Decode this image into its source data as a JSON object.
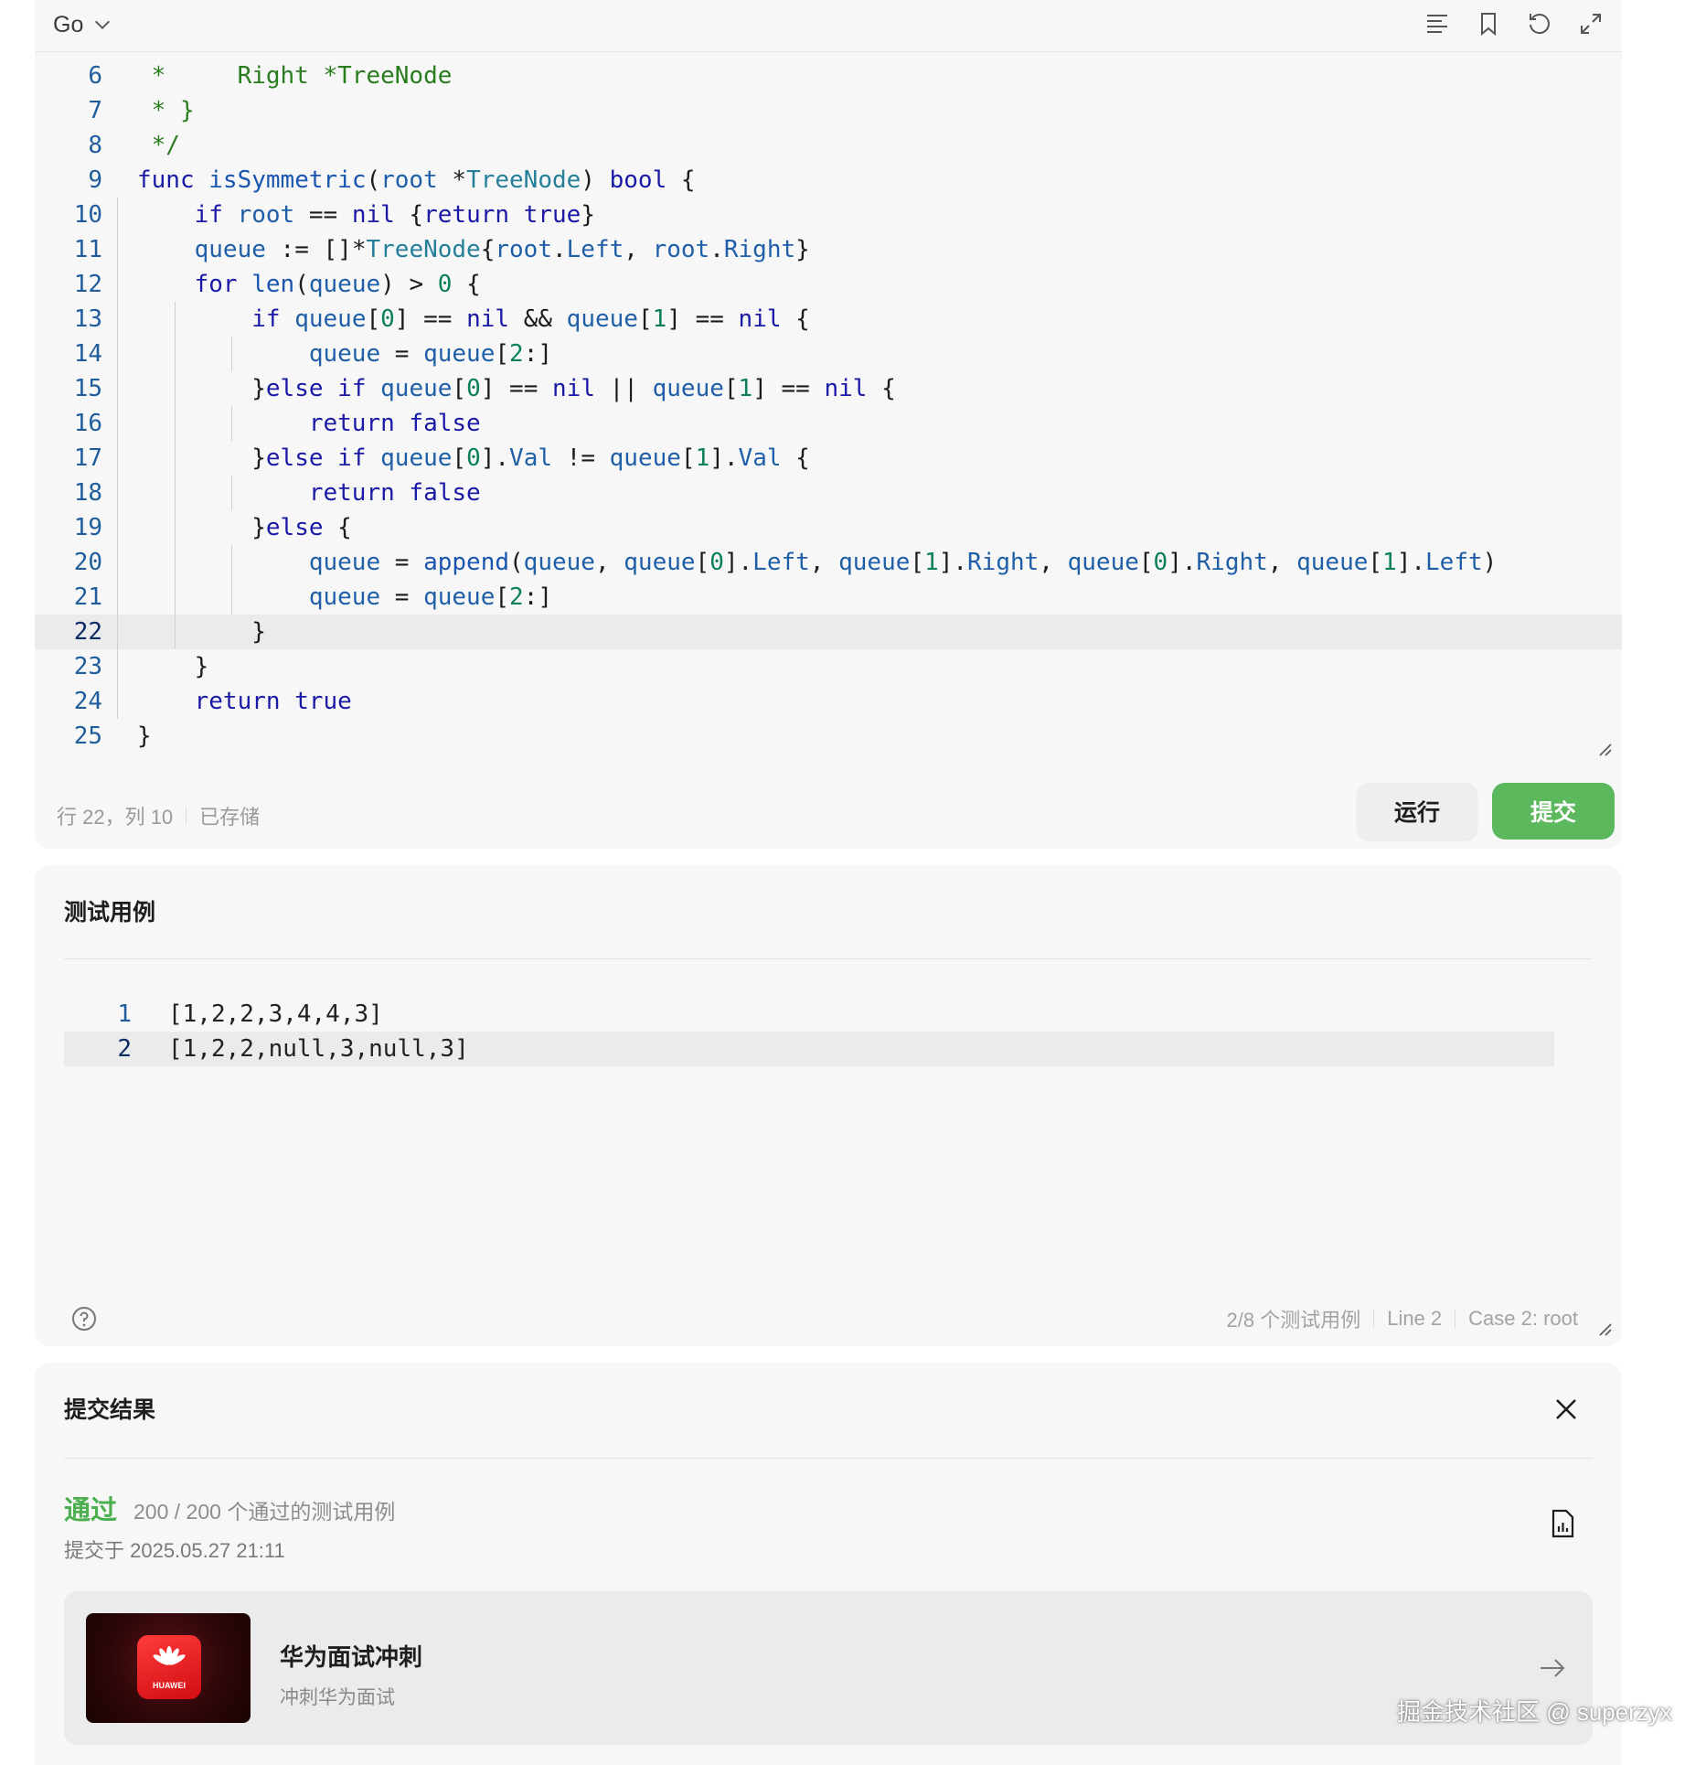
{
  "editor": {
    "language": "Go",
    "code_lines": [
      {
        "n": "6",
        "html": "<span class='c'> *     Right *TreeNode</span>"
      },
      {
        "n": "7",
        "html": "<span class='c'> * }</span>"
      },
      {
        "n": "8",
        "html": "<span class='c'> */</span>"
      },
      {
        "n": "9",
        "html": "<span class='k'>func</span> <span class='f'>isSymmetric</span>(<span class='v'>root</span> *<span class='t'>TreeNode</span>) <span class='k'>bool</span> {"
      },
      {
        "n": "10",
        "html": "    <span class='k'>if</span> <span class='v'>root</span> == <span class='k'>nil</span> {<span class='k'>return</span> <span class='k'>true</span>}"
      },
      {
        "n": "11",
        "html": "    <span class='v'>queue</span> := []*<span class='t'>TreeNode</span>{<span class='v'>root</span>.<span class='v'>Left</span>, <span class='v'>root</span>.<span class='v'>Right</span>}"
      },
      {
        "n": "12",
        "html": "    <span class='k'>for</span> <span class='f'>len</span>(<span class='v'>queue</span>) > <span class='n'>0</span> {"
      },
      {
        "n": "13",
        "html": "        <span class='k'>if</span> <span class='v'>queue</span>[<span class='n'>0</span>] == <span class='k'>nil</span> && <span class='v'>queue</span>[<span class='n'>1</span>] == <span class='k'>nil</span> {"
      },
      {
        "n": "14",
        "html": "            <span class='v'>queue</span> = <span class='v'>queue</span>[<span class='n'>2</span>:]"
      },
      {
        "n": "15",
        "html": "        }<span class='k'>else</span> <span class='k'>if</span> <span class='v'>queue</span>[<span class='n'>0</span>] == <span class='k'>nil</span> || <span class='v'>queue</span>[<span class='n'>1</span>] == <span class='k'>nil</span> {"
      },
      {
        "n": "16",
        "html": "            <span class='k'>return</span> <span class='k'>false</span>"
      },
      {
        "n": "17",
        "html": "        }<span class='k'>else</span> <span class='k'>if</span> <span class='v'>queue</span>[<span class='n'>0</span>].<span class='v'>Val</span> != <span class='v'>queue</span>[<span class='n'>1</span>].<span class='v'>Val</span> {"
      },
      {
        "n": "18",
        "html": "            <span class='k'>return</span> <span class='k'>false</span>"
      },
      {
        "n": "19",
        "html": "        }<span class='k'>else</span> {"
      },
      {
        "n": "20",
        "html": "            <span class='v'>queue</span> = <span class='f'>append</span>(<span class='v'>queue</span>, <span class='v'>queue</span>[<span class='n'>0</span>].<span class='v'>Left</span>, <span class='v'>queue</span>[<span class='n'>1</span>].<span class='v'>Right</span>, <span class='v'>queue</span>[<span class='n'>0</span>].<span class='v'>Right</span>, <span class='v'>queue</span>[<span class='n'>1</span>].<span class='v'>Left</span>)"
      },
      {
        "n": "21",
        "html": "            <span class='v'>queue</span> = <span class='v'>queue</span>[<span class='n'>2</span>:]"
      },
      {
        "n": "22",
        "html": "        }",
        "active": true
      },
      {
        "n": "23",
        "html": "    }"
      },
      {
        "n": "24",
        "html": "    <span class='k'>return</span> <span class='k'>true</span>"
      },
      {
        "n": "25",
        "html": "}"
      }
    ],
    "cursor_position": "行 22，列 10",
    "save_status": "已存储",
    "run_label": "运行",
    "submit_label": "提交"
  },
  "tests": {
    "title": "测试用例",
    "lines": [
      {
        "n": "1",
        "text": "[1,2,2,3,4,4,3]"
      },
      {
        "n": "2",
        "text": "[1,2,2,null,3,null,3]",
        "active": true
      }
    ],
    "case_count": "2/8 个测试用例",
    "line_info": "Line 2",
    "case_info": "Case 2: root"
  },
  "result": {
    "title": "提交结果",
    "status": "通过",
    "passed_count": "200 / 200",
    "passed_label": "个通过的测试用例",
    "submitted_at": "提交于 2025.05.27 21:11",
    "promo_title": "华为面试冲刺",
    "promo_subtitle": "冲刺华为面试",
    "promo_logo_text": "HUAWEI"
  },
  "watermark": "掘金技术社区 @ superzyx",
  "icons": [
    "chevron-down-icon",
    "format-icon",
    "bookmark-icon",
    "reset-icon",
    "fullscreen-icon",
    "help-icon",
    "close-icon",
    "report-icon",
    "arrow-right-icon",
    "huawei-logo"
  ],
  "colors": {
    "accent_green": "#5cb85c",
    "pass_green": "#4caf50",
    "keyword": "#1a1aa6",
    "comment": "#2a7d1f"
  }
}
